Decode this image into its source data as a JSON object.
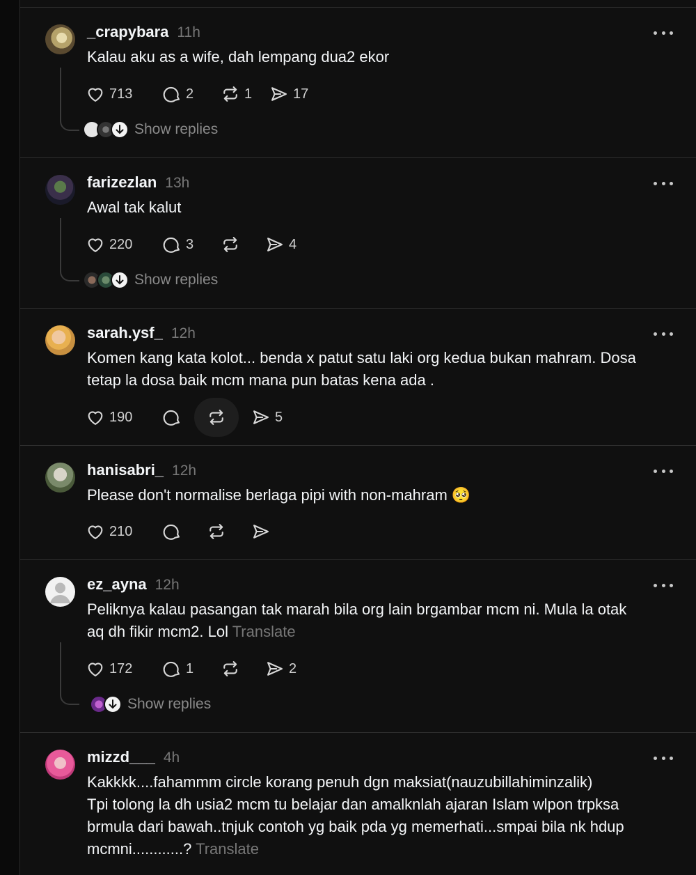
{
  "colors": {
    "background": "#101010",
    "text": "#f3f5f7",
    "muted": "#777777",
    "divider": "#2e2e2e"
  },
  "posts": [
    {
      "username": "_crapybara",
      "time": "11h",
      "lines": [
        "Kalau aku as a wife, dah lempang dua2 ekor"
      ],
      "likes": "713",
      "comments": "2",
      "reposts": "1",
      "shares": "17",
      "show_replies": "Show replies",
      "avatar_icon": "profile-photo-icon"
    },
    {
      "username": "farizezlan",
      "time": "13h",
      "lines": [
        "Awal tak kalut"
      ],
      "likes": "220",
      "comments": "3",
      "reposts": "",
      "shares": "4",
      "show_replies": "Show replies",
      "avatar_icon": "profile-photo-icon"
    },
    {
      "username": "sarah.ysf_",
      "time": "12h",
      "lines": [
        "Komen kang kata kolot... benda x patut satu laki org kedua bukan mahram. Dosa",
        "tetap la dosa baik mcm mana pun batas kena ada ."
      ],
      "likes": "190",
      "comments": "",
      "reposts": "",
      "shares": "5",
      "avatar_icon": "profile-photo-icon"
    },
    {
      "username": "hanisabri_",
      "time": "12h",
      "lines": [
        "Please don't normalise berlaga pipi with non-mahram 🥺"
      ],
      "likes": "210",
      "comments": "",
      "reposts": "",
      "shares": "",
      "avatar_icon": "profile-photo-icon"
    },
    {
      "username": "ez_ayna",
      "time": "12h",
      "lines": [
        "Peliknya kalau pasangan tak marah bila org lain brgambar mcm ni. Mula la otak",
        "aq dh fikir mcm2. Lol"
      ],
      "translate": "Translate",
      "likes": "172",
      "comments": "1",
      "reposts": "",
      "shares": "2",
      "show_replies": "Show replies",
      "avatar_icon": "default-avatar-icon"
    },
    {
      "username": "mizzd___",
      "time": "4h",
      "lines": [
        "Kakkkk....fahammm circle korang penuh dgn maksiat(nauzubillahiminzalik)",
        "Tpi tolong la dh usia2 mcm tu belajar dan amalknlah ajaran Islam wlpon trpksa",
        "brmula dari bawah..tnjuk contoh yg baik pda yg memerhati...smpai bila nk hdup",
        "mcmni............?"
      ],
      "translate": "Translate",
      "avatar_icon": "profile-photo-icon"
    }
  ]
}
